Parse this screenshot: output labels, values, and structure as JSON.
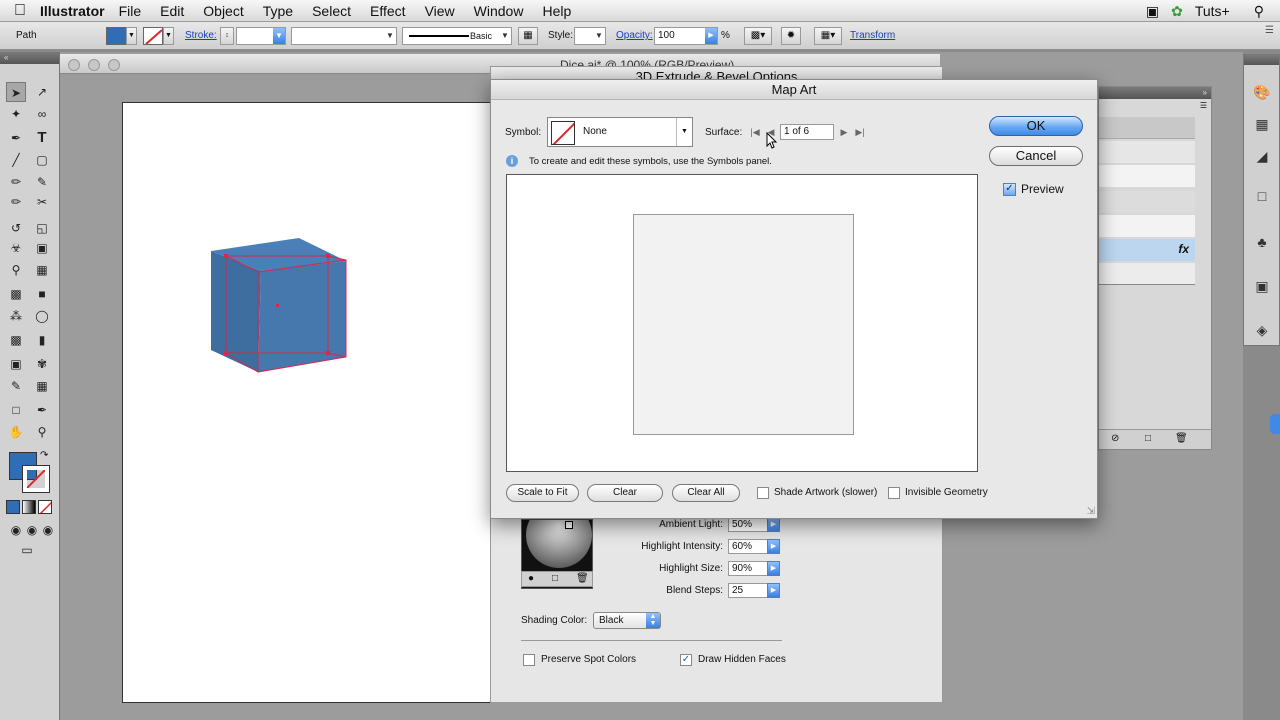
{
  "menubar": {
    "app_name": "Illustrator",
    "items": [
      "File",
      "Edit",
      "Object",
      "Type",
      "Select",
      "Effect",
      "View",
      "Window",
      "Help"
    ],
    "brand": "Tuts+"
  },
  "controlbar": {
    "selection_type": "Path",
    "stroke_label": "Stroke:",
    "brush_label": "Basic",
    "style_label": "Style:",
    "opacity_label": "Opacity:",
    "opacity_value": "100",
    "percent": "%",
    "transform_label": "Transform",
    "fill_color": "#2f6db5"
  },
  "document": {
    "title": "Dice.ai* @ 100% (RGB/Preview)"
  },
  "extrude_dialog": {
    "title": "3D Extrude & Bevel Options",
    "ambient_light_label": "Ambient Light:",
    "ambient_light_value": "50%",
    "highlight_intensity_label": "Highlight Intensity:",
    "highlight_intensity_value": "60%",
    "highlight_size_label": "Highlight Size:",
    "highlight_size_value": "90%",
    "blend_steps_label": "Blend Steps:",
    "blend_steps_value": "25",
    "shading_color_label": "Shading Color:",
    "shading_color_value": "Black",
    "preserve_spot_colors_label": "Preserve Spot Colors",
    "preserve_spot_colors_checked": false,
    "draw_hidden_faces_label": "Draw Hidden Faces",
    "draw_hidden_faces_checked": true
  },
  "map_art": {
    "title": "Map Art",
    "symbol_label": "Symbol:",
    "symbol_value": "None",
    "surface_label": "Surface:",
    "surface_value": "1 of 6",
    "info_text": "To create and edit these symbols, use the Symbols panel.",
    "ok_label": "OK",
    "cancel_label": "Cancel",
    "preview_label": "Preview",
    "preview_checked": true,
    "scale_to_fit_label": "Scale to Fit",
    "clear_label": "Clear",
    "clear_all_label": "Clear All",
    "shade_artwork_label": "Shade Artwork (slower)",
    "shade_artwork_checked": false,
    "invisible_geometry_label": "Invisible Geometry",
    "invisible_geometry_checked": false
  },
  "panel": {
    "fx_label": "fx"
  }
}
